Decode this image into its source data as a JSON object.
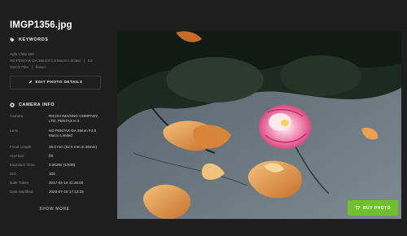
{
  "photo": {
    "filename": "IMGP1356.jpg"
  },
  "keywords": {
    "heading": "KEYWORDS",
    "lines": [
      [
        "Agfa Vista 100"
      ],
      [
        "HD PENTAX-DA 35mmF2.8 Macro Limited",
        "K3"
      ],
      [
        "VSCO Film",
        "flower"
      ]
    ]
  },
  "edit_button": {
    "label": "EDIT PHOTO DETAILS"
  },
  "camera_info": {
    "heading": "CAMERA INFO",
    "rows": [
      {
        "key": "Camera",
        "value": "RICOH IMAGING COMPANY, LTD. PENTAX K-3"
      },
      {
        "key": "Lens",
        "value": "HD PENTAX-DA 35mm F2.8 Macro Limited"
      },
      {
        "key": "Focal Length",
        "value": "35.0 mm (52.0 mm in 35mm)"
      },
      {
        "key": "Aperture",
        "value": "f/8"
      },
      {
        "key": "Exposure Time",
        "value": "0.0025s (1/400)"
      },
      {
        "key": "ISO",
        "value": "100"
      },
      {
        "key": "Date Taken",
        "value": "2017-04-16 11:46:00"
      },
      {
        "key": "Date Modified",
        "value": "2020-07-18 17:12:25"
      }
    ]
  },
  "show_more": {
    "label": "SHOW MORE"
  },
  "buy_button": {
    "label": "BUY PHOTO"
  },
  "colors": {
    "accent": "#6fbf2e",
    "background": "#1e1e1e"
  },
  "icons": [
    "tag-icon",
    "pencil-icon",
    "camera-icon",
    "cart-icon"
  ]
}
